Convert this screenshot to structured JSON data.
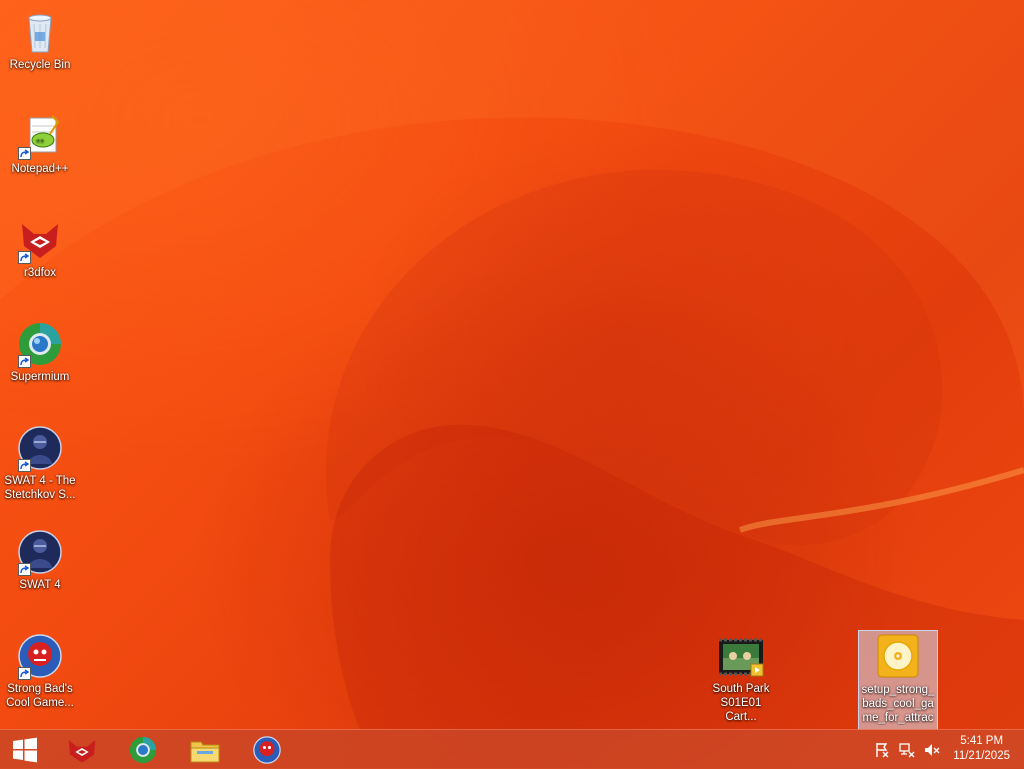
{
  "desktop": {
    "icons": [
      {
        "label": "Recycle Bin",
        "icon": "recycle-bin-icon"
      },
      {
        "label": "Notepad++",
        "icon": "notepad-plus-plus-icon"
      },
      {
        "label": "r3dfox",
        "icon": "r3dfox-icon"
      },
      {
        "label": "Supermium",
        "icon": "supermium-icon"
      },
      {
        "label": "SWAT 4 - The Stetchkov S...",
        "icon": "swat4-stetchkov-icon"
      },
      {
        "label": "SWAT 4",
        "icon": "swat4-icon"
      },
      {
        "label": "Strong Bad's Cool Game...",
        "icon": "strong-bad-icon"
      },
      {
        "label": "South Park S01E01 Cart...",
        "icon": "video-file-icon"
      },
      {
        "label": "setup_strong_bads_cool_game_for_attrac",
        "icon": "disc-installer-icon"
      }
    ]
  },
  "taskbar": {
    "start": "windows-start-icon",
    "pinned": [
      "r3dfox-icon",
      "supermium-icon",
      "file-explorer-icon",
      "strong-bad-icon"
    ],
    "tray": [
      "action-center-flag-icon",
      "network-icon",
      "volume-muted-icon"
    ],
    "clock": {
      "time": "5:41 PM",
      "date": "11/21/2025"
    }
  },
  "colors": {
    "wallpaper": "#f24a10",
    "taskbar": "#c8462a"
  }
}
